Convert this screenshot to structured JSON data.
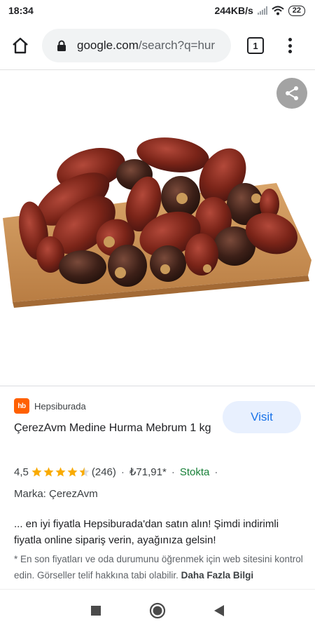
{
  "status_bar": {
    "time": "18:34",
    "network_speed": "244KB/s",
    "battery_level": "22"
  },
  "browser": {
    "url_domain": "google.com",
    "url_path": "/search?q=hur",
    "tab_count": "1",
    "icons": [
      "home-icon",
      "lock-icon",
      "tab-switcher-icon",
      "more-vert-icon"
    ]
  },
  "image_viewer": {
    "share_icon": "share-icon"
  },
  "result": {
    "source_name": "Hepsiburada",
    "source_logo_text": "hb",
    "title": "ÇerezAvm Medine Hurma Mebrum 1 kg",
    "visit_label": "Visit",
    "rating": "4,5",
    "rating_value": 4.5,
    "reviews": "(246)",
    "price": "₺71,91*",
    "stock": "Stokta",
    "brand": "Marka: ÇerezAvm",
    "description": "... en iyi fiyatla Hepsiburada'dan satın alın! Şimdi indirimli fiyatla online sipariş verin, ayağınıza gelsin!",
    "note": "* En son fiyatları ve oda durumunu öğrenmek için web sitesini kontrol edin. Görseller telif hakkına tabi olabilir.",
    "note_more": "Daha Fazla Bilgi"
  },
  "colors": {
    "accent": "#1a73e8",
    "visit_bg": "#e8f0fe",
    "stock_green": "#188038",
    "star": "#f9ab00",
    "hb_orange": "#ff6000"
  }
}
